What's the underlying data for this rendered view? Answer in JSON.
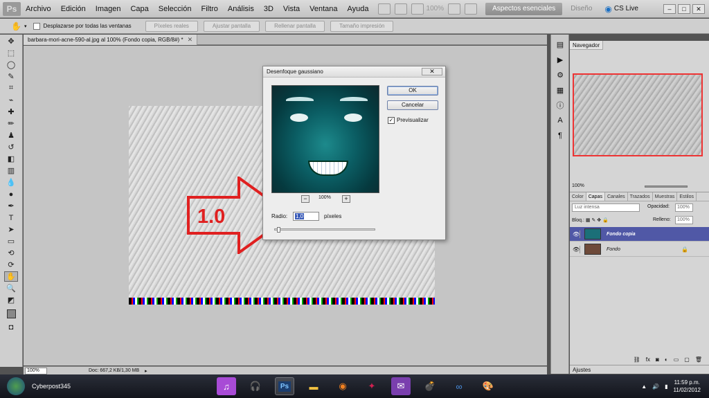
{
  "app": {
    "logo": "Ps",
    "menu": [
      "Archivo",
      "Edición",
      "Imagen",
      "Capa",
      "Selección",
      "Filtro",
      "Análisis",
      "3D",
      "Vista",
      "Ventana",
      "Ayuda"
    ],
    "zoom_menu": "100%",
    "workspace_active": "Aspectos esenciales",
    "workspace_other": "Diseño",
    "cslive": "CS Live"
  },
  "options_bar": {
    "scroll_all_label": "Desplazarse por todas las ventanas",
    "buttons": [
      "Píxeles reales",
      "Ajustar pantalla",
      "Rellenar pantalla",
      "Tamaño impresión"
    ]
  },
  "document": {
    "tab_title": "barbara-mori-acne-590-al.jpg al 100% (Fondo copia, RGB/8#) *",
    "zoom": "100%",
    "doc_info": "Doc: 667,2 KB/1,30 MB",
    "annotation": "1.0"
  },
  "dialog": {
    "title": "Desenfoque gaussiano",
    "ok": "OK",
    "cancel": "Cancelar",
    "preview_label": "Previsualizar",
    "preview_checked": true,
    "zoom": "100%",
    "zoom_minus": "−",
    "zoom_plus": "+",
    "radius_label": "Radio:",
    "radius_value": "1,0",
    "units": "píxeles"
  },
  "navigator": {
    "tab": "Navegador",
    "zoom": "100%"
  },
  "layers": {
    "tabs": [
      "Color",
      "Capas",
      "Canales",
      "Trazados",
      "Muestras",
      "Estilos"
    ],
    "active_tab": "Capas",
    "blend_mode": "Luz intensa",
    "opacity_label": "Opacidad:",
    "opacity": "100%",
    "lock_label": "Bloq.:",
    "fill_label": "Relleno:",
    "fill": "100%",
    "items": [
      {
        "name": "Fondo copia",
        "selected": true
      },
      {
        "name": "Fondo",
        "selected": false
      }
    ]
  },
  "adjustments": {
    "tab": "Ajustes"
  },
  "taskbar": {
    "user": "Cyberpost345",
    "time": "11:59 p.m.",
    "date": "11/02/2012"
  },
  "colors": {
    "accent": "#5058a6",
    "annotation": "#e02020"
  }
}
